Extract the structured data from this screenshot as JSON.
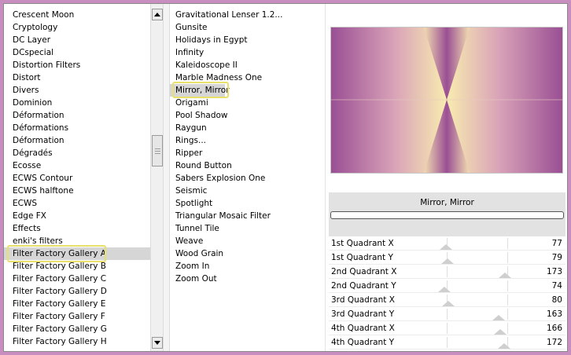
{
  "categories": {
    "items": [
      "Crescent Moon",
      "Cryptology",
      "DC Layer",
      "DCspecial",
      "Distortion Filters",
      "Distort",
      "Divers",
      "Dominion",
      "Déformation",
      "Déformations",
      "Déformation",
      "Dégradés",
      "Ecosse",
      "ECWS Contour",
      "ECWS halftone",
      "ECWS",
      "Edge FX",
      "Effects",
      "enki's filters",
      "Filter Factory Gallery A",
      "Filter Factory Gallery B",
      "Filter Factory Gallery C",
      "Filter Factory Gallery D",
      "Filter Factory Gallery E",
      "Filter Factory Gallery F",
      "Filter Factory Gallery G",
      "Filter Factory Gallery H"
    ],
    "selected_index": 19
  },
  "filters": {
    "items": [
      "Gravitational Lenser 1.2...",
      "Gunsite",
      "Holidays in Egypt",
      "Infinity",
      "Kaleidoscope II",
      "Marble Madness One",
      "Mirror, Mirror",
      "Origami",
      "Pool Shadow",
      "Raygun",
      "Rings...",
      "Ripper",
      "Round Button",
      "Sabers Explosion One",
      "Seismic",
      "Spotlight",
      "Triangular Mosaic Filter",
      "Tunnel Tile",
      "Weave",
      "Wood Grain",
      "Zoom In",
      "Zoom Out"
    ],
    "selected_index": 6
  },
  "icons": {
    "scroll_up": "scroll-up-arrow-icon",
    "scroll_down": "scroll-down-arrow-icon"
  },
  "panel": {
    "filter_title": "Mirror, Mirror",
    "progress": 0
  },
  "parameters": [
    {
      "label": "1st Quadrant X",
      "value": 77
    },
    {
      "label": "1st Quadrant Y",
      "value": 79
    },
    {
      "label": "2nd Quadrant X",
      "value": 173
    },
    {
      "label": "2nd Quadrant Y",
      "value": 74
    },
    {
      "label": "3rd Quadrant X",
      "value": 80
    },
    {
      "label": "3rd Quadrant Y",
      "value": 163
    },
    {
      "label": "4th Quadrant X",
      "value": 166
    },
    {
      "label": "4th Quadrant Y",
      "value": 172
    }
  ],
  "slider_max": 255,
  "colors": {
    "background": "#c88ec0",
    "highlight_border": "#e8e06a",
    "preview_purple": "#9a4f94",
    "preview_yellow": "#f8ecb0"
  }
}
